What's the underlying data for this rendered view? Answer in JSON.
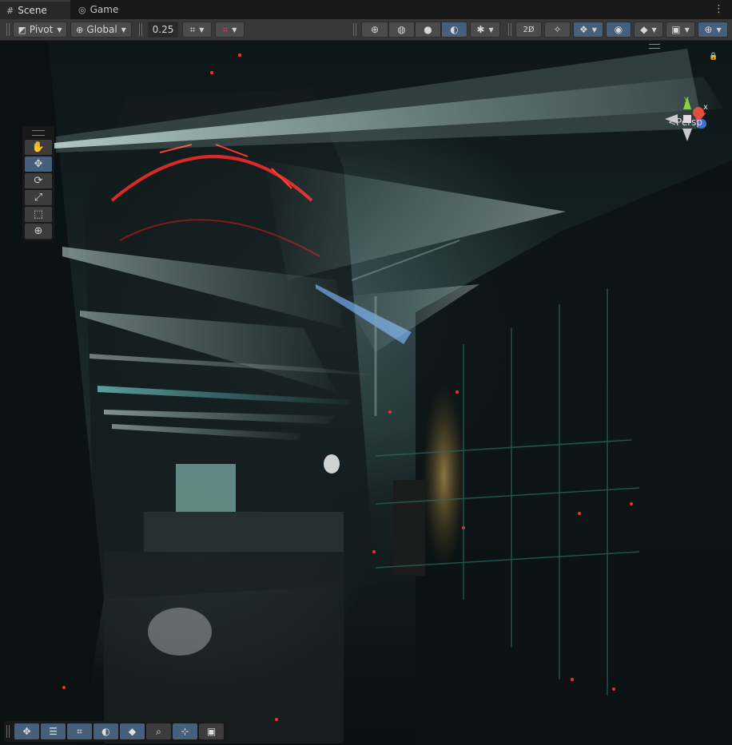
{
  "tabs": [
    {
      "label": "Scene",
      "icon": "grid-icon",
      "active": true
    },
    {
      "label": "Game",
      "icon": "gamepad-icon",
      "active": false
    }
  ],
  "toolbar": {
    "pivot_label": "Pivot",
    "global_label": "Global",
    "snap_value": "0.25"
  },
  "tools": [
    {
      "name": "hand-tool",
      "glyph": "✋"
    },
    {
      "name": "move-tool",
      "glyph": "✥"
    },
    {
      "name": "rotate-tool",
      "glyph": "⟳"
    },
    {
      "name": "scale-tool",
      "glyph": "⤢"
    },
    {
      "name": "rect-tool",
      "glyph": "⬚"
    },
    {
      "name": "transform-tool",
      "glyph": "⊕"
    }
  ],
  "gizmo": {
    "label": "<Persp",
    "y_axis": "y",
    "x_axis": "x"
  },
  "overlays": [
    "move-overlay",
    "tool-settings-overlay",
    "grid-overlay",
    "shading-overlay",
    "layers-overlay",
    "search-overlay",
    "snapping-overlay",
    "camera-overlay"
  ],
  "colors": {
    "accent": "#46607c",
    "toolbar_bg": "#383838",
    "tab_bg": "#191919"
  }
}
